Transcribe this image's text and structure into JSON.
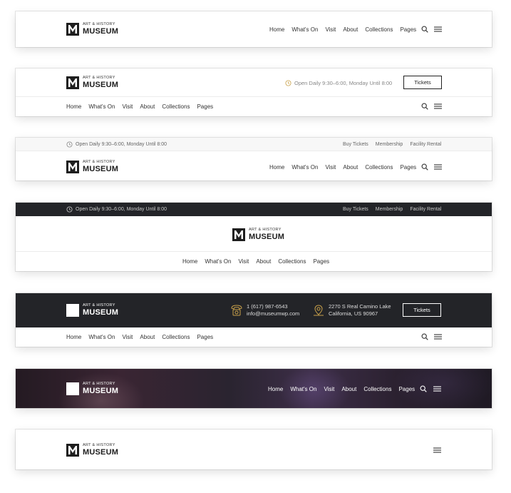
{
  "logo": {
    "small": "ART & HISTORY",
    "big": "MUSEUM"
  },
  "nav": [
    "Home",
    "What's On",
    "Visit",
    "About",
    "Collections",
    "Pages"
  ],
  "hours": "Open Daily 9:30–6:00, Monday Until 8:00",
  "top_links": [
    "Buy Tickets",
    "Membership",
    "Facility Rental"
  ],
  "tickets_label": "Tickets",
  "contact": {
    "phone": "1 (617) 987-6543",
    "email": "info@museumwp.com",
    "address_line1": "2270 S Real Camino Lake",
    "address_line2": "California, US 90967"
  },
  "icons": {
    "search": "search-icon",
    "menu": "hamburger-menu-icon",
    "clock": "clock-icon",
    "phone": "phone-icon",
    "location": "map-pin-icon",
    "logo": "museum-m-logo"
  },
  "colors": {
    "dark_bar": "#232428",
    "accent": "#c9a14a",
    "text": "#333333",
    "muted": "#777777"
  }
}
